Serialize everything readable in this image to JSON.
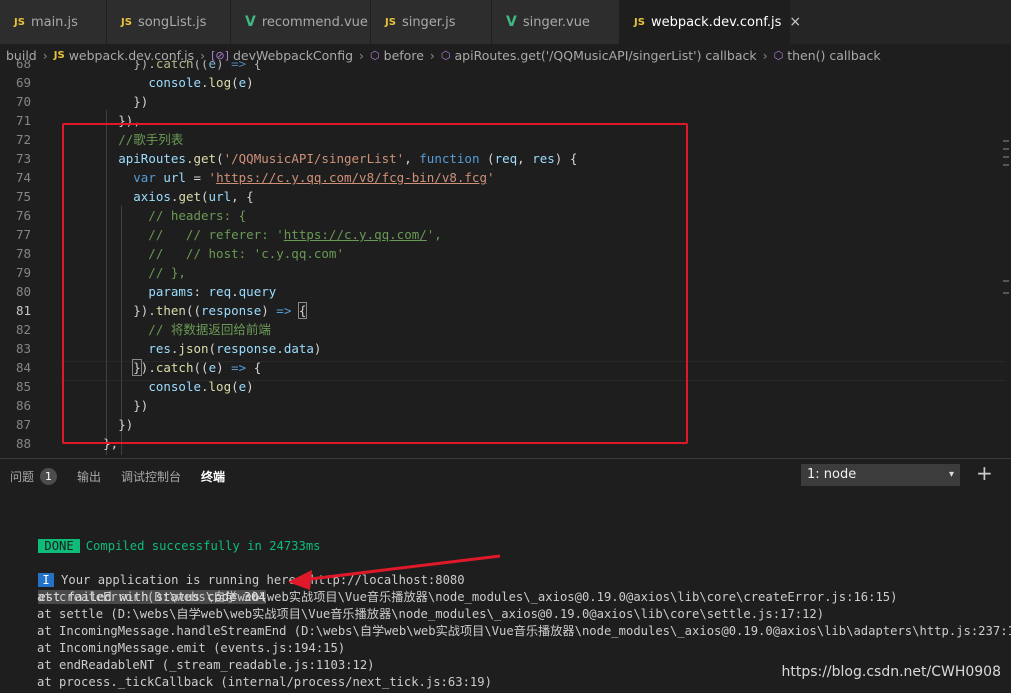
{
  "tabs": [
    {
      "icon": "JS",
      "label": "main.js",
      "kind": "js"
    },
    {
      "icon": "V",
      "label": "songList.js",
      "kind": "js"
    },
    {
      "icon": "V",
      "label": "recommend.vue",
      "kind": "vue"
    },
    {
      "icon": "JS",
      "label": "singer.js",
      "kind": "js"
    },
    {
      "icon": "V",
      "label": "singer.vue",
      "kind": "vue"
    },
    {
      "icon": "JS",
      "label": "webpack.dev.conf.js",
      "kind": "js",
      "active": true
    }
  ],
  "tab_close": "×",
  "breadcrumb": {
    "items": [
      "build",
      "webpack.dev.conf.js",
      "devWebpackConfig",
      "before",
      "apiRoutes.get('/QQMusicAPI/singerList') callback",
      "then() callback"
    ],
    "sep": "›",
    "js_icon": "JS"
  },
  "editor": {
    "lines": [
      {
        "n": "68",
        "t": "          }).catch((e) => {"
      },
      {
        "n": "69",
        "t": "            console.log(e)"
      },
      {
        "n": "70",
        "t": "          })"
      },
      {
        "n": "71",
        "t": "        }),"
      },
      {
        "n": "72",
        "t": "        //歌手列表"
      },
      {
        "n": "73",
        "t": "        apiRoutes.get('/QQMusicAPI/singerList', function (req, res) {"
      },
      {
        "n": "74",
        "t": "          var url = 'https://c.y.qq.com/v8/fcg-bin/v8.fcg'"
      },
      {
        "n": "75",
        "t": "          axios.get(url, {"
      },
      {
        "n": "76",
        "t": "            // headers: {"
      },
      {
        "n": "77",
        "t": "            //   // referer: 'https://c.y.qq.com/',"
      },
      {
        "n": "78",
        "t": "            //   // host: 'c.y.qq.com'"
      },
      {
        "n": "79",
        "t": "            // },"
      },
      {
        "n": "80",
        "t": "            params: req.query"
      },
      {
        "n": "81",
        "t": "          }).then((response) => {"
      },
      {
        "n": "82",
        "t": "            // 将数据返回给前端"
      },
      {
        "n": "83",
        "t": "            res.json(response.data)"
      },
      {
        "n": "84",
        "t": "          }).catch((e) => {"
      },
      {
        "n": "85",
        "t": "            console.log(e)"
      },
      {
        "n": "86",
        "t": "          })"
      },
      {
        "n": "87",
        "t": "        })"
      },
      {
        "n": "88",
        "t": "      },"
      }
    ]
  },
  "panel": {
    "tabs": [
      "问题",
      "输出",
      "调试控制台",
      "终端"
    ],
    "problems_count": "1",
    "terminal_select": "1: node",
    "select_arrow": "▾",
    "plus": "+"
  },
  "terminal": {
    "done_badge": "DONE",
    "done_text": "Compiled successfully in 24733ms",
    "info_badge": "I",
    "info_text": "Your application is running here: http://localhost:8080",
    "error_line": "est failed with status code 304",
    "stack": [
      "at createError (D:\\webs\\自学web\\web实战项目\\Vue音乐播放器\\node_modules\\_axios@0.19.0@axios\\lib\\core\\createError.js:16:15)",
      "at settle (D:\\webs\\自学web\\web实战项目\\Vue音乐播放器\\node_modules\\_axios@0.19.0@axios\\lib\\core\\settle.js:17:12)",
      "at IncomingMessage.handleStreamEnd (D:\\webs\\自学web\\web实战项目\\Vue音乐播放器\\node_modules\\_axios@0.19.0@axios\\lib\\adapters\\http.js:237:11)",
      "at IncomingMessage.emit (events.js:194:15)",
      "at endReadableNT (_stream_readable.js:1103:12)",
      "at process._tickCallback (internal/process/next_tick.js:63:19)"
    ]
  },
  "watermark": "https://blog.csdn.net/CWH0908",
  "colors": {
    "highlight_box": "#e0192a",
    "arrow": "#e0192a",
    "done": "#0dbc79",
    "info": "#2472c8"
  }
}
